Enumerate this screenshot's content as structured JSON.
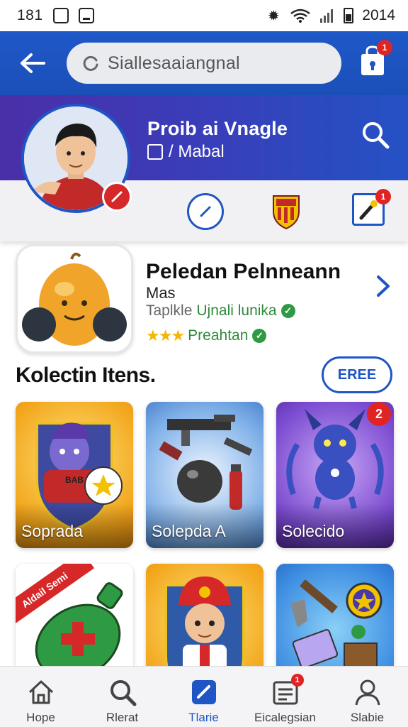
{
  "status_bar": {
    "time": "181",
    "clock": "2014"
  },
  "search": {
    "placeholder": "Siallesaaiangnal"
  },
  "cart": {
    "badge": "1"
  },
  "profile": {
    "name": "Proib ai Vnagle",
    "subtitle": "/ Mabal",
    "action_badge": "1"
  },
  "featured": {
    "title": "Peledan Pelnneann",
    "subtitle": "Mas",
    "meta_grey": "Taplkle",
    "meta_green": "Ujnali lunika",
    "rating_stars": "★★★",
    "rating_label": "Preahtan"
  },
  "section": {
    "title": "Kolectin Itens.",
    "button": "EREE"
  },
  "grid": [
    {
      "label": "Soprada",
      "shirt_text": "BAB"
    },
    {
      "label": "Solepda A"
    },
    {
      "label": "Solecido",
      "badge": "2"
    },
    {
      "ribbon": "Aldail Semi"
    },
    {
      "label": ""
    },
    {
      "label": ""
    }
  ],
  "bottom_nav": [
    {
      "label": "Hope",
      "icon": "home-icon"
    },
    {
      "label": "Rlerat",
      "icon": "search-icon"
    },
    {
      "label": "Tlarie",
      "icon": "edit-icon",
      "active": true
    },
    {
      "label": "Eicalegsian",
      "icon": "inbox-icon",
      "badge": "1"
    },
    {
      "label": "Slabie",
      "icon": "profile-icon"
    }
  ],
  "colors": {
    "primary": "#1f55c5",
    "header_purple": "#4a2fa8",
    "badge_red": "#e02424",
    "green": "#2e8b3a"
  }
}
